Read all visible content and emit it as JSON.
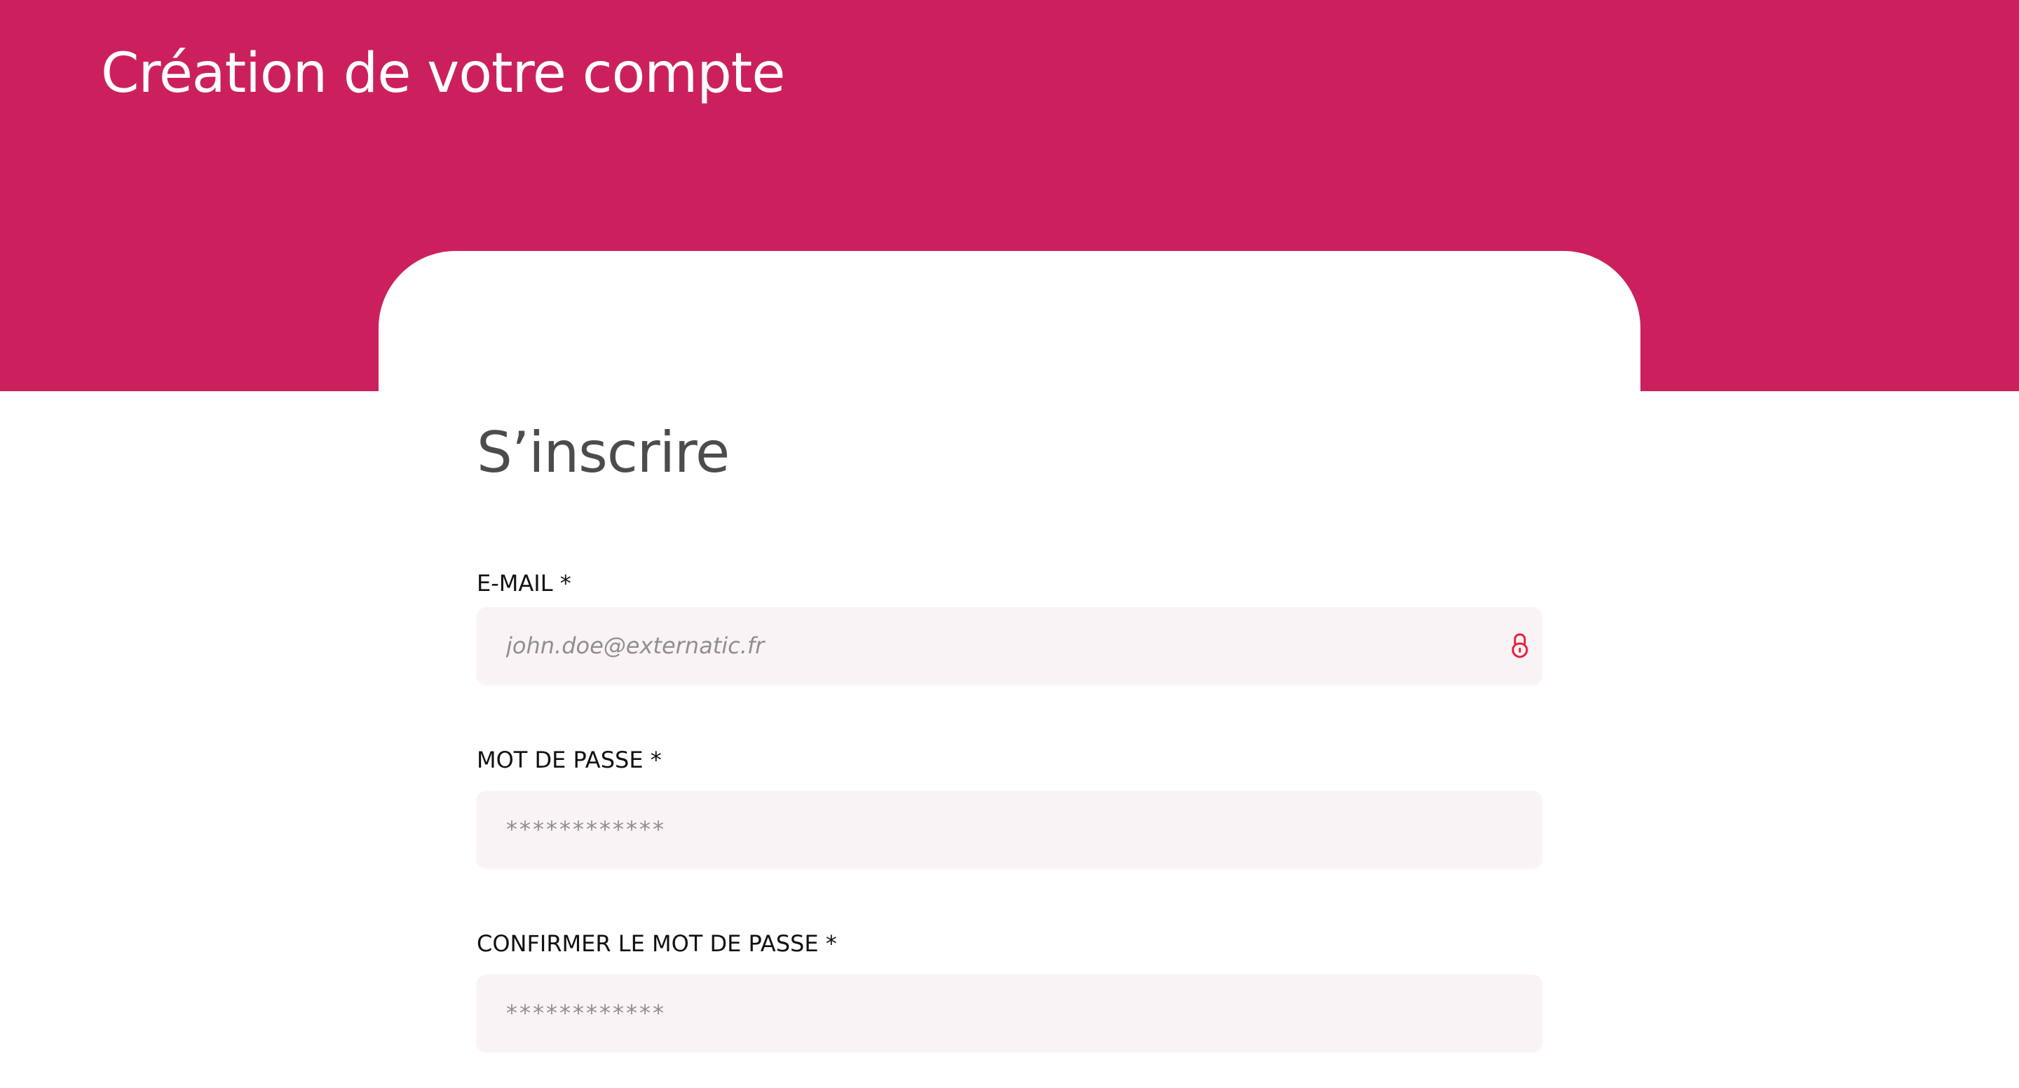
{
  "page": {
    "header_title": "Création de votre compte",
    "card_title": "S’inscrire"
  },
  "colors": {
    "brand": "#cc205e",
    "field_background": "#faf3f5",
    "lock_icon": "#e6203d"
  },
  "form": {
    "email": {
      "label": "E-MAIL *",
      "value": "",
      "placeholder": "john.doe@externatic.fr",
      "icon": "lock-icon"
    },
    "password": {
      "label": "MOT DE PASSE *",
      "value": "",
      "placeholder": "************"
    },
    "confirm_password": {
      "label": "CONFIRMER LE MOT DE PASSE *",
      "value": "",
      "placeholder": "************"
    }
  }
}
